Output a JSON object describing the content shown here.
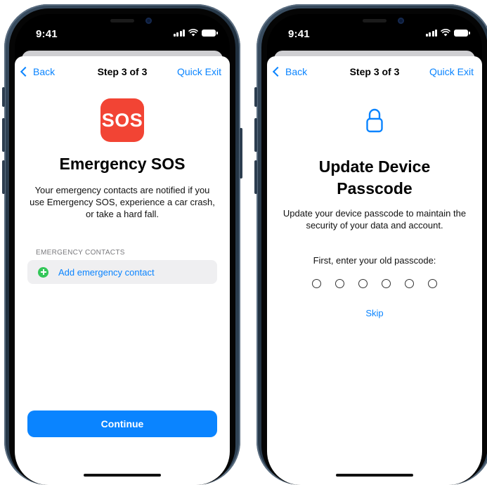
{
  "phones": [
    {
      "status": {
        "time": "9:41"
      },
      "nav": {
        "back": "Back",
        "title": "Step 3 of 3",
        "exit": "Quick Exit"
      },
      "icon": {
        "name": "sos-icon",
        "text": "SOS",
        "color": "#F24434"
      },
      "title": "Emergency SOS",
      "description": "Your emergency contacts are notified if you use Emergency SOS, experience a car crash, or take a hard fall.",
      "section_label": "EMERGENCY CONTACTS",
      "add_contact": "Add emergency contact",
      "continue_label": "Continue"
    },
    {
      "status": {
        "time": "9:41"
      },
      "nav": {
        "back": "Back",
        "title": "Step 3 of 3",
        "exit": "Quick Exit"
      },
      "icon": {
        "name": "lock-icon",
        "color": "#0A84FF"
      },
      "title": "Update Device Passcode",
      "description": "Update your device passcode to maintain the security of your data and account.",
      "passcode_prompt": "First, enter your old passcode:",
      "passcode_length": 6,
      "skip_label": "Skip"
    }
  ],
  "colors": {
    "accent": "#0A84FF",
    "add_green": "#34C759",
    "sos_red": "#F24434"
  }
}
